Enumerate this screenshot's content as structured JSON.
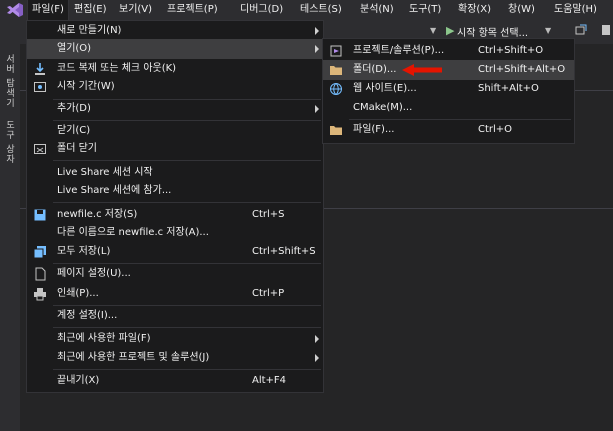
{
  "menubar": {
    "items": [
      "파일(F)",
      "편집(E)",
      "보기(V)",
      "프로젝트(P)",
      "디버그(D)",
      "테스트(S)",
      "분석(N)",
      "도구(T)",
      "확장(X)",
      "창(W)",
      "도움말(H)"
    ]
  },
  "toolbar": {
    "start_label": "시작 항목 선택..."
  },
  "side_tabs": {
    "server_explorer": "서버 탐색기",
    "toolbox": "도구 상자"
  },
  "file_menu": {
    "new": "새로 만들기(N)",
    "open": "열기(O)",
    "clone": "코드 복제 또는 체크 아웃(K)",
    "start_window": "시작 기간(W)",
    "add": "추가(D)",
    "close": "닫기(C)",
    "close_folder": "폴더 닫기",
    "live_share_start": "Live Share 세션 시작",
    "live_share_join": "Live Share 세션에 참가...",
    "save": "newfile.c 저장(S)",
    "save_shortcut": "Ctrl+S",
    "save_as": "다른 이름으로 newfile.c 저장(A)...",
    "save_all": "모두 저장(L)",
    "save_all_shortcut": "Ctrl+Shift+S",
    "page_setup": "페이지 설정(U)...",
    "print": "인쇄(P)...",
    "print_shortcut": "Ctrl+P",
    "account": "계정 설정(I)...",
    "recent_files": "최근에 사용한 파일(F)",
    "recent_projects": "최근에 사용한 프로젝트 및 솔루션(J)",
    "exit": "끝내기(X)",
    "exit_shortcut": "Alt+F4"
  },
  "open_submenu": {
    "project": "프로젝트/솔루션(P)...",
    "project_shortcut": "Ctrl+Shift+O",
    "folder": "폴더(D)...",
    "folder_shortcut": "Ctrl+Shift+Alt+O",
    "website": "웹 사이트(E)...",
    "website_shortcut": "Shift+Alt+O",
    "cmake": "CMake(M)...",
    "file": "파일(F)...",
    "file_shortcut": "Ctrl+O"
  },
  "colors": {
    "accent_logo": "#865fc5",
    "highlight_arrow": "#e51400",
    "menu_bg": "#1b1b1c",
    "hover_bg": "#3e3e40"
  }
}
